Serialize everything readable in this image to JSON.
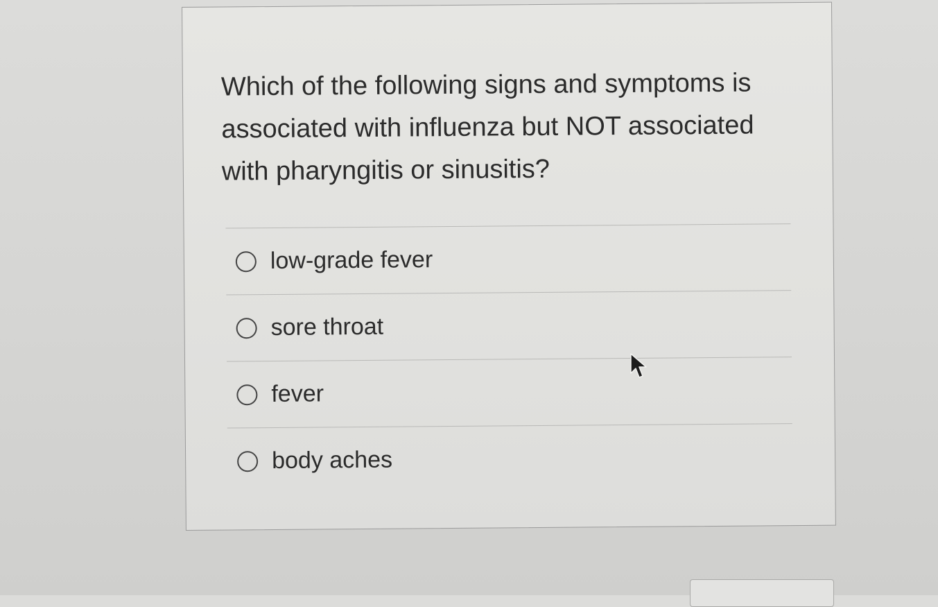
{
  "question": {
    "text": "Which of the following signs and symptoms is associated with influenza but NOT associated with pharyngitis or sinusitis?"
  },
  "answers": [
    {
      "label": "low-grade fever",
      "selected": false
    },
    {
      "label": "sore throat",
      "selected": false
    },
    {
      "label": "fever",
      "selected": false
    },
    {
      "label": "body aches",
      "selected": false
    }
  ],
  "icons": {
    "radio": "radio-unchecked-icon",
    "cursor": "mouse-pointer-icon"
  },
  "colors": {
    "text": "#2b2b2b",
    "border": "#9b9b9b",
    "background": "#dcdcda"
  }
}
